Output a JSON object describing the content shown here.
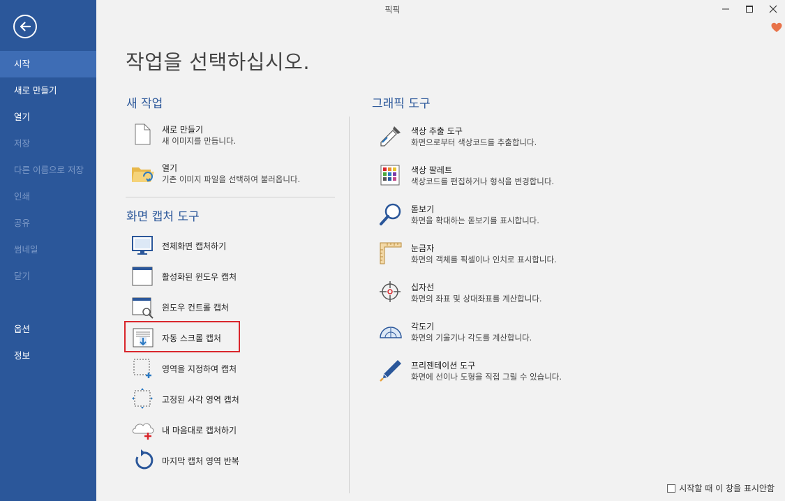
{
  "app": {
    "title": "픽픽"
  },
  "sidebar": {
    "items": [
      {
        "label": "시작",
        "state": "active"
      },
      {
        "label": "새로 만들기",
        "state": "normal"
      },
      {
        "label": "열기",
        "state": "normal"
      },
      {
        "label": "저장",
        "state": "disabled"
      },
      {
        "label": "다른 이름으로 저장",
        "state": "disabled"
      },
      {
        "label": "인쇄",
        "state": "disabled"
      },
      {
        "label": "공유",
        "state": "disabled"
      },
      {
        "label": "썸네일",
        "state": "disabled"
      },
      {
        "label": "닫기",
        "state": "disabled"
      }
    ],
    "bottom_items": [
      {
        "label": "옵션"
      },
      {
        "label": "정보"
      }
    ]
  },
  "main": {
    "title": "작업을 선택하십시오.",
    "new_task": {
      "title": "새 작업",
      "items": [
        {
          "label": "새로 만들기",
          "desc": "새 이미지를 만듭니다.",
          "icon": "blank-document-icon"
        },
        {
          "label": "열기",
          "desc": "기존 이미지 파일을 선택하여 불러옵니다.",
          "icon": "open-folder-icon"
        }
      ]
    },
    "capture_tools": {
      "title": "화면 캡처 도구",
      "items": [
        {
          "label": "전체화면 캡처하기",
          "icon": "monitor-icon"
        },
        {
          "label": "활성화된 윈도우 캡처",
          "icon": "window-icon"
        },
        {
          "label": "윈도우 컨트롤 캡처",
          "icon": "window-magnify-icon"
        },
        {
          "label": "자동 스크롤 캡처",
          "icon": "scroll-capture-icon"
        },
        {
          "label": "영역을 지정하여 캡처",
          "icon": "region-select-icon"
        },
        {
          "label": "고정된 사각 영역 캡처",
          "icon": "fixed-region-icon"
        },
        {
          "label": "내 마음대로 캡처하기",
          "icon": "freehand-cloud-icon"
        },
        {
          "label": "마지막 캡처 영역 반복",
          "icon": "repeat-icon"
        }
      ]
    },
    "graphic_tools": {
      "title": "그래픽 도구",
      "items": [
        {
          "label": "색상 추출 도구",
          "desc": "화면으로부터 색상코드를 추출합니다.",
          "icon": "eyedropper-icon"
        },
        {
          "label": "색상 팔레트",
          "desc": "색상코드를 편집하거나 형식을 변경합니다.",
          "icon": "palette-grid-icon"
        },
        {
          "label": "돋보기",
          "desc": "화면을 확대하는 돋보기를 표시합니다.",
          "icon": "magnifier-icon"
        },
        {
          "label": "눈금자",
          "desc": "화면의 객체를 픽셀이나 인치로 표시합니다.",
          "icon": "ruler-icon"
        },
        {
          "label": "십자선",
          "desc": "화면의 좌표 및 상대좌표를 계산합니다.",
          "icon": "crosshair-icon"
        },
        {
          "label": "각도기",
          "desc": "화면의 기울기나 각도를 계산합니다.",
          "icon": "protractor-icon"
        },
        {
          "label": "프리젠테이션 도구",
          "desc": "화면에 선이나 도형을 직접 그릴 수 있습니다.",
          "icon": "pen-icon"
        }
      ]
    }
  },
  "footer": {
    "checkbox_label": "시작할 때 이 창을 표시안함",
    "checked": false
  },
  "colors": {
    "sidebar": "#2b579a",
    "sidebar_active": "#3e6db5",
    "accent": "#2b579a",
    "highlight": "#d9262c",
    "heart": "#e8734a"
  }
}
